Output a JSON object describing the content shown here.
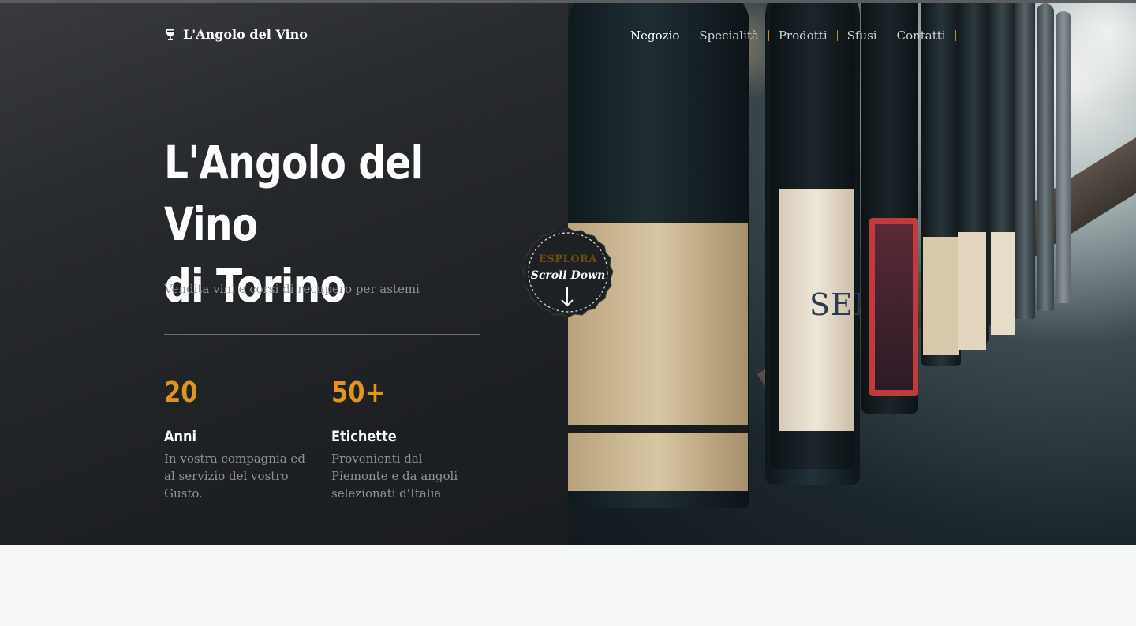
{
  "brand": {
    "name": "L'Angolo del Vino",
    "icon": "wine-glass-icon"
  },
  "nav": {
    "items": [
      {
        "label": "Negozio",
        "active": true
      },
      {
        "label": "Specialità"
      },
      {
        "label": "Prodotti"
      },
      {
        "label": "Sfusi"
      },
      {
        "label": "Contatti"
      }
    ]
  },
  "hero": {
    "title_line1": "L'Angolo del Vino",
    "title_line2": "di Torino",
    "subtitle": "Vendita vini e corsi di recupero per astemi"
  },
  "stats": [
    {
      "number": "20",
      "label": "Anni",
      "description": "In vostra compagnia ed al servizio del vostro Gusto."
    },
    {
      "number": "50+",
      "label": "Etichette",
      "description": "Provenienti dal Piemonte e da angoli selezionati d'Italia"
    }
  ],
  "badge": {
    "top": "ESPLORA",
    "main": "Scroll Down",
    "icon": "arrow-down-icon"
  },
  "photo": {
    "label_text": "SENS",
    "colors": {
      "amber": "#e0951c",
      "label": "#e7d8b8"
    }
  }
}
